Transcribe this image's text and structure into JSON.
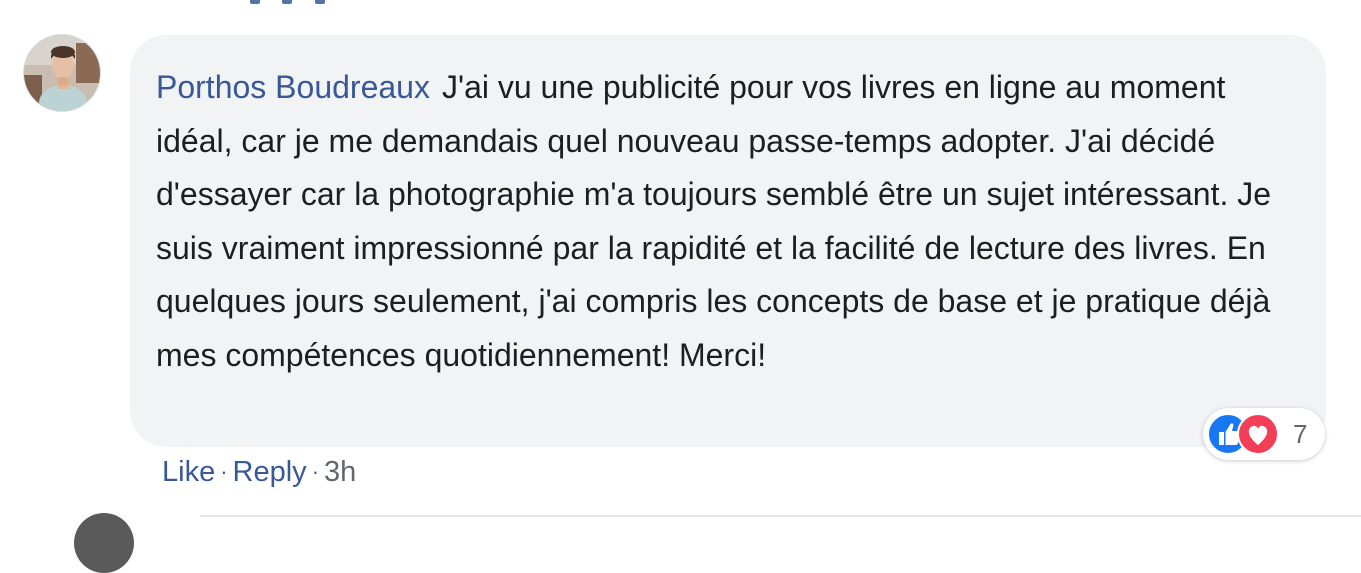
{
  "comment": {
    "author": "Porthos Boudreaux",
    "text": "J'ai vu une publicité pour vos livres en ligne au moment idéal, car je me demandais quel nouveau passe-temps adopter. J'ai décidé d'essayer car la photographie m'a toujours semblé être un sujet intéressant. Je suis vraiment impressionné par la rapidité et la facilité de lecture des livres. En quelques jours seulement, j'ai compris les concepts de base et je pratique déjà mes compétences quotidiennement! Merci!",
    "reactions": {
      "icons": [
        "like-icon",
        "love-icon"
      ],
      "count": "7"
    },
    "actions": {
      "like_label": "Like",
      "reply_label": "Reply",
      "separator": "·",
      "timestamp": "3h"
    }
  },
  "colors": {
    "bubble_bg": "#f2f3f5",
    "author": "#385898",
    "text": "#1c1e21",
    "like_blue": "#1877f2",
    "love_red": "#f33e58",
    "timestamp": "#616770"
  }
}
